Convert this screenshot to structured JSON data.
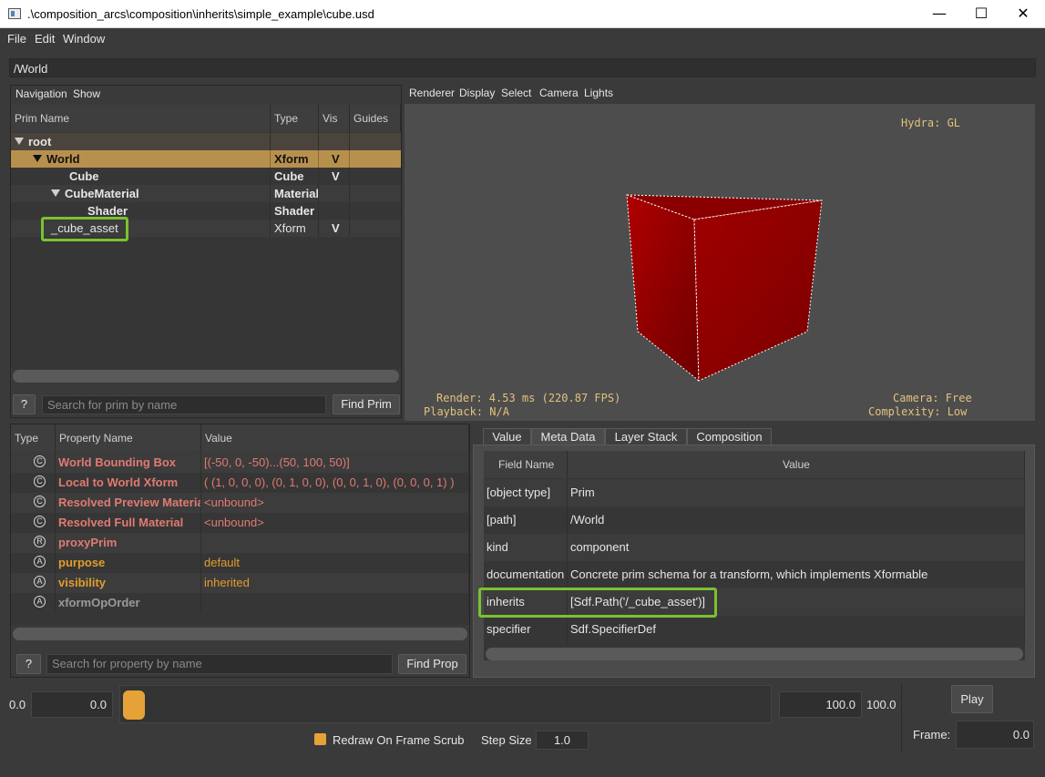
{
  "window": {
    "title": ".\\composition_arcs\\composition\\inherits\\simple_example\\cube.usd",
    "minimize": "—",
    "maximize": "☐",
    "close": "✕"
  },
  "menu": [
    "File",
    "Edit",
    "Window"
  ],
  "path": "/World",
  "prim_panel": {
    "menu": [
      "Navigation",
      "Show"
    ],
    "columns": [
      "Prim Name",
      "Type",
      "Vis",
      "Guides"
    ],
    "rows": [
      {
        "name": "root",
        "type": "",
        "vis": ""
      },
      {
        "name": "World",
        "type": "Xform",
        "vis": "V"
      },
      {
        "name": "Cube",
        "type": "Cube",
        "vis": "V"
      },
      {
        "name": "CubeMaterial",
        "type": "Material",
        "vis": ""
      },
      {
        "name": "Shader",
        "type": "Shader",
        "vis": ""
      },
      {
        "name": "_cube_asset",
        "type": "Xform",
        "vis": "V"
      }
    ],
    "help": "?",
    "search_placeholder": "Search for prim by name",
    "find": "Find Prim"
  },
  "viewport": {
    "menu": [
      "Renderer",
      "Display",
      "Select",
      "Camera",
      "Lights"
    ],
    "hydra": "Hydra: GL",
    "render": "Render: 4.53 ms (220.87 FPS)",
    "playback": "Playback: N/A",
    "camera": "Camera: Free",
    "complexity": "Complexity: Low",
    "cube_color": "#8f0000"
  },
  "property_panel": {
    "columns": [
      "Type",
      "Property Name",
      "Value"
    ],
    "rows": [
      {
        "icon": "C",
        "name": "World Bounding Box",
        "value": "[(-50, 0, -50)...(50, 100, 50)]"
      },
      {
        "icon": "C",
        "name": "Local to World Xform",
        "value": "( (1, 0, 0, 0), (0, 1, 0, 0), (0, 0, 1, 0), (0, 0, 0, 1) )"
      },
      {
        "icon": "C",
        "name": "Resolved Preview Material",
        "value": "<unbound>"
      },
      {
        "icon": "C",
        "name": "Resolved Full Material",
        "value": "<unbound>"
      },
      {
        "icon": "R",
        "name": "proxyPrim",
        "value": ""
      },
      {
        "icon": "A",
        "name": "purpose",
        "value": "default"
      },
      {
        "icon": "A",
        "name": "visibility",
        "value": "inherited"
      },
      {
        "icon": "A",
        "name": "xformOpOrder",
        "value": ""
      }
    ],
    "help": "?",
    "search_placeholder": "Search for property by name",
    "find": "Find Prop"
  },
  "meta_panel": {
    "tabs": [
      "Value",
      "Meta Data",
      "Layer Stack",
      "Composition"
    ],
    "columns": [
      "Field Name",
      "Value"
    ],
    "rows": [
      {
        "field": "[object type]",
        "value": "Prim"
      },
      {
        "field": "[path]",
        "value": "/World"
      },
      {
        "field": "kind",
        "value": "component"
      },
      {
        "field": "documentation",
        "value": "Concrete prim schema for a transform, which implements Xformable"
      },
      {
        "field": "inherits",
        "value": "[Sdf.Path('/_cube_asset')]"
      },
      {
        "field": "specifier",
        "value": "Sdf.SpecifierDef"
      }
    ]
  },
  "timeline": {
    "start_label": "0.0",
    "start_value": "0.0",
    "end_value": "100.0",
    "end_label": "100.0",
    "play": "Play",
    "redraw": "Redraw On Frame Scrub",
    "step_label": "Step Size",
    "step_value": "1.0",
    "frame_label": "Frame:",
    "frame_value": "0.0"
  },
  "colors": {
    "selected_row": "#b8904e",
    "highlight": "#7ac231",
    "computed_prop": "#e07a72",
    "attr_prop": "#e39d2c"
  }
}
